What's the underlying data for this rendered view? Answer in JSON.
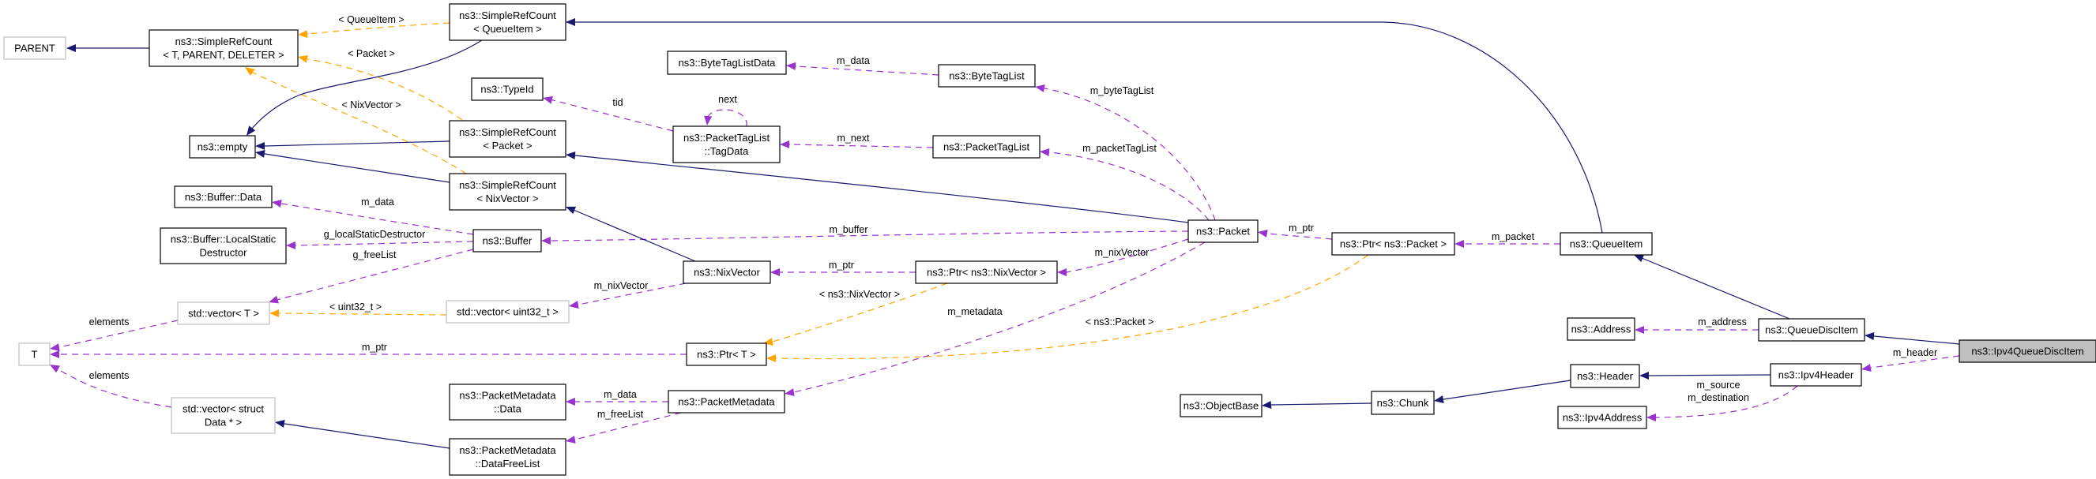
{
  "diagram": {
    "title": "ns3::Ipv4QueueDiscItem collaboration graph",
    "colors": {
      "inherit": "#191970",
      "member": "#9a32cd",
      "template": "#ffa500",
      "focus_fill": "#bfbfbf",
      "external_border": "#bfbfbf"
    },
    "nodes": [
      {
        "id": "parent",
        "lines": [
          "PARENT"
        ],
        "kind": "external"
      },
      {
        "id": "simplerefcount_generic",
        "lines": [
          "ns3::SimpleRefCount",
          "< T, PARENT, DELETER >"
        ],
        "kind": "class"
      },
      {
        "id": "simplerefcount_queueitem",
        "lines": [
          "ns3::SimpleRefCount",
          "< QueueItem >"
        ],
        "kind": "class"
      },
      {
        "id": "empty",
        "lines": [
          "ns3::empty"
        ],
        "kind": "class"
      },
      {
        "id": "typeid",
        "lines": [
          "ns3::TypeId"
        ],
        "kind": "class"
      },
      {
        "id": "bytetaglistdata",
        "lines": [
          "ns3::ByteTagListData"
        ],
        "kind": "class"
      },
      {
        "id": "bytetaglist",
        "lines": [
          "ns3::ByteTagList"
        ],
        "kind": "class"
      },
      {
        "id": "packettaglist_tagdata",
        "lines": [
          "ns3::PacketTagList",
          "::TagData"
        ],
        "kind": "class"
      },
      {
        "id": "packettaglist",
        "lines": [
          "ns3::PacketTagList"
        ],
        "kind": "class"
      },
      {
        "id": "simplerefcount_packet",
        "lines": [
          "ns3::SimpleRefCount",
          "< Packet >"
        ],
        "kind": "class"
      },
      {
        "id": "simplerefcount_nixvector",
        "lines": [
          "ns3::SimpleRefCount",
          "< NixVector >"
        ],
        "kind": "class"
      },
      {
        "id": "buffer_data",
        "lines": [
          "ns3::Buffer::Data"
        ],
        "kind": "class"
      },
      {
        "id": "buffer_lsd",
        "lines": [
          "ns3::Buffer::LocalStatic",
          "Destructor"
        ],
        "kind": "class"
      },
      {
        "id": "buffer",
        "lines": [
          "ns3::Buffer"
        ],
        "kind": "class"
      },
      {
        "id": "packet",
        "lines": [
          "ns3::Packet"
        ],
        "kind": "class"
      },
      {
        "id": "ptr_packet",
        "lines": [
          "ns3::Ptr< ns3::Packet >"
        ],
        "kind": "class"
      },
      {
        "id": "queueitem",
        "lines": [
          "ns3::QueueItem"
        ],
        "kind": "class"
      },
      {
        "id": "vector_t",
        "lines": [
          "std::vector< T >"
        ],
        "kind": "external"
      },
      {
        "id": "vector_uint32",
        "lines": [
          "std::vector< uint32_t >"
        ],
        "kind": "external"
      },
      {
        "id": "nixvector",
        "lines": [
          "ns3::NixVector"
        ],
        "kind": "class"
      },
      {
        "id": "ptr_nixvector",
        "lines": [
          "ns3::Ptr< ns3::NixVector >"
        ],
        "kind": "class"
      },
      {
        "id": "t",
        "lines": [
          "T"
        ],
        "kind": "external"
      },
      {
        "id": "ptr_t",
        "lines": [
          "ns3::Ptr< T >"
        ],
        "kind": "class"
      },
      {
        "id": "address",
        "lines": [
          "ns3::Address"
        ],
        "kind": "class"
      },
      {
        "id": "queuedisc_item",
        "lines": [
          "ns3::QueueDiscItem"
        ],
        "kind": "class"
      },
      {
        "id": "ipv4queuedisc_item",
        "lines": [
          "ns3::Ipv4QueueDiscItem"
        ],
        "kind": "focus"
      },
      {
        "id": "header",
        "lines": [
          "ns3::Header"
        ],
        "kind": "class"
      },
      {
        "id": "ipv4header",
        "lines": [
          "ns3::Ipv4Header"
        ],
        "kind": "class"
      },
      {
        "id": "objectbase",
        "lines": [
          "ns3::ObjectBase"
        ],
        "kind": "class"
      },
      {
        "id": "chunk",
        "lines": [
          "ns3::Chunk"
        ],
        "kind": "class"
      },
      {
        "id": "ipv4address",
        "lines": [
          "ns3::Ipv4Address"
        ],
        "kind": "class"
      },
      {
        "id": "vector_struct_data",
        "lines": [
          "std::vector< struct",
          "Data * >"
        ],
        "kind": "external"
      },
      {
        "id": "pm_data",
        "lines": [
          "ns3::PacketMetadata",
          "::Data"
        ],
        "kind": "class"
      },
      {
        "id": "packetmetadata",
        "lines": [
          "ns3::PacketMetadata"
        ],
        "kind": "class"
      },
      {
        "id": "pm_datafreelist",
        "lines": [
          "ns3::PacketMetadata",
          "::DataFreeList"
        ],
        "kind": "class"
      }
    ],
    "edges": [
      {
        "from": "simplerefcount_generic",
        "to": "parent",
        "type": "inherit",
        "label": ""
      },
      {
        "from": "simplerefcount_queueitem",
        "to": "simplerefcount_generic",
        "type": "template",
        "label": "< QueueItem >"
      },
      {
        "from": "simplerefcount_packet",
        "to": "simplerefcount_generic",
        "type": "template",
        "label": "< Packet >"
      },
      {
        "from": "simplerefcount_nixvector",
        "to": "simplerefcount_generic",
        "type": "template",
        "label": "< NixVector >"
      },
      {
        "from": "simplerefcount_queueitem",
        "to": "empty",
        "type": "inherit",
        "label": ""
      },
      {
        "from": "simplerefcount_packet",
        "to": "empty",
        "type": "inherit",
        "label": ""
      },
      {
        "from": "simplerefcount_nixvector",
        "to": "empty",
        "type": "inherit",
        "label": ""
      },
      {
        "from": "queueitem",
        "to": "simplerefcount_queueitem",
        "type": "inherit",
        "label": ""
      },
      {
        "from": "bytetaglist",
        "to": "bytetaglistdata",
        "type": "member",
        "label": "m_data"
      },
      {
        "from": "packettaglist_tagdata",
        "to": "typeid",
        "type": "member",
        "label": "tid"
      },
      {
        "from": "packettaglist_tagdata",
        "to": "packettaglist_tagdata",
        "type": "member",
        "label": "next"
      },
      {
        "from": "packettaglist",
        "to": "packettaglist_tagdata",
        "type": "member",
        "label": "m_next"
      },
      {
        "from": "packet",
        "to": "bytetaglist",
        "type": "member",
        "label": "m_byteTagList"
      },
      {
        "from": "packet",
        "to": "packettaglist",
        "type": "member",
        "label": "m_packetTagList"
      },
      {
        "from": "packet",
        "to": "simplerefcount_packet",
        "type": "inherit",
        "label": ""
      },
      {
        "from": "buffer",
        "to": "buffer_data",
        "type": "member",
        "label": "m_data"
      },
      {
        "from": "buffer",
        "to": "buffer_lsd",
        "type": "member",
        "label": "g_localStaticDestructor"
      },
      {
        "from": "buffer",
        "to": "vector_t",
        "type": "member",
        "label": "g_freeList"
      },
      {
        "from": "packet",
        "to": "buffer",
        "type": "member",
        "label": "m_buffer"
      },
      {
        "from": "ptr_packet",
        "to": "packet",
        "type": "member",
        "label": "m_ptr"
      },
      {
        "from": "queueitem",
        "to": "ptr_packet",
        "type": "member",
        "label": "m_packet"
      },
      {
        "from": "nixvector",
        "to": "simplerefcount_nixvector",
        "type": "inherit",
        "label": ""
      },
      {
        "from": "nixvector",
        "to": "vector_uint32",
        "type": "member",
        "label": "m_nixVector"
      },
      {
        "from": "ptr_nixvector",
        "to": "nixvector",
        "type": "member",
        "label": "m_ptr"
      },
      {
        "from": "packet",
        "to": "ptr_nixvector",
        "type": "member",
        "label": "m_nixVector"
      },
      {
        "from": "vector_uint32",
        "to": "vector_t",
        "type": "template",
        "label": "< uint32_t >"
      },
      {
        "from": "vector_t",
        "to": "t",
        "type": "member",
        "label": "elements"
      },
      {
        "from": "ptr_t",
        "to": "t",
        "type": "member",
        "label": "m_ptr"
      },
      {
        "from": "ptr_nixvector",
        "to": "ptr_t",
        "type": "template",
        "label": "< ns3::NixVector >"
      },
      {
        "from": "ptr_packet",
        "to": "ptr_t",
        "type": "template",
        "label": "< ns3::Packet >"
      },
      {
        "from": "packet",
        "to": "packetmetadata",
        "type": "member",
        "label": "m_metadata"
      },
      {
        "from": "queuedisc_item",
        "to": "queueitem",
        "type": "inherit",
        "label": ""
      },
      {
        "from": "queuedisc_item",
        "to": "address",
        "type": "member",
        "label": "m_address"
      },
      {
        "from": "ipv4queuedisc_item",
        "to": "queuedisc_item",
        "type": "inherit",
        "label": ""
      },
      {
        "from": "ipv4queuedisc_item",
        "to": "ipv4header",
        "type": "member",
        "label": "m_header"
      },
      {
        "from": "ipv4header",
        "to": "header",
        "type": "inherit",
        "label": ""
      },
      {
        "from": "header",
        "to": "chunk",
        "type": "inherit",
        "label": ""
      },
      {
        "from": "chunk",
        "to": "objectbase",
        "type": "inherit",
        "label": ""
      },
      {
        "from": "ipv4header",
        "to": "ipv4address",
        "type": "member",
        "label": "m_source\nm_destination"
      },
      {
        "from": "vector_struct_data",
        "to": "t",
        "type": "member",
        "label": "elements"
      },
      {
        "from": "pm_datafreelist",
        "to": "vector_struct_data",
        "type": "inherit",
        "label": ""
      },
      {
        "from": "packetmetadata",
        "to": "pm_data",
        "type": "member",
        "label": "m_data"
      },
      {
        "from": "packetmetadata",
        "to": "pm_datafreelist",
        "type": "member",
        "label": "m_freeList"
      }
    ]
  }
}
